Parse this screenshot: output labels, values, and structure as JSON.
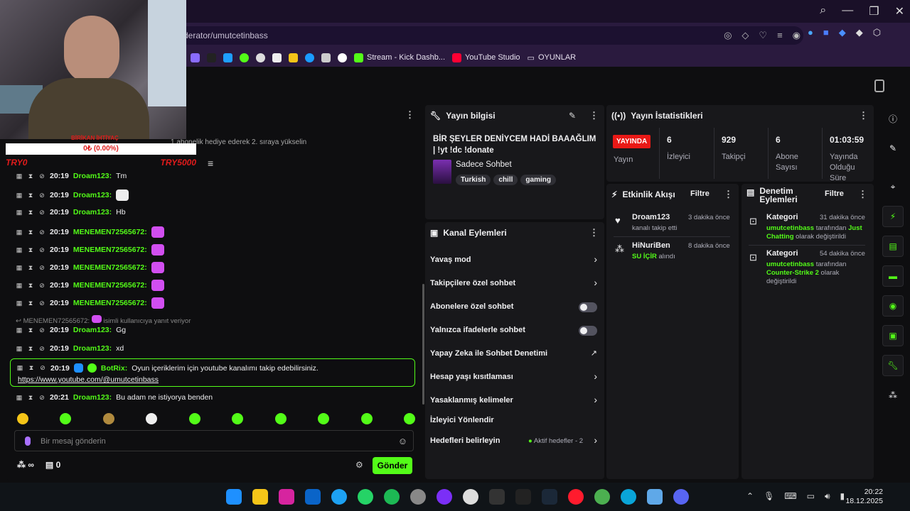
{
  "browser": {
    "address": "derator/umutcetinbass",
    "bookmarks": [
      "Stream - Kick Dashb...",
      "YouTube Studio",
      "OYUNLAR"
    ]
  },
  "overlay": {
    "top_text": "BİRİKAN İHTİYAÇ",
    "progress": "0₺ (0.00%)",
    "progress_value": 0,
    "left_label": "TRY0",
    "right_label": "TRY5000"
  },
  "chat": {
    "info": "1 abonelik hediye ederek 2. sıraya yükselin",
    "messages": [
      {
        "time": "20:19",
        "user": "Droam123:",
        "text": "Tm"
      },
      {
        "time": "20:19",
        "user": "Droam123:",
        "text": ""
      },
      {
        "time": "20:19",
        "user": "Droam123:",
        "text": "Hb"
      },
      {
        "time": "20:19",
        "user": "MENEMEN72565672:",
        "text": ""
      },
      {
        "time": "20:19",
        "user": "MENEMEN72565672:",
        "text": ""
      },
      {
        "time": "20:19",
        "user": "MENEMEN72565672:",
        "text": ""
      },
      {
        "time": "20:19",
        "user": "MENEMEN72565672:",
        "text": ""
      },
      {
        "time": "20:19",
        "user": "MENEMEN72565672:",
        "text": ""
      }
    ],
    "reply_prefix": "MENEMEN72565672:",
    "reply_suffix": "isimli kullanıcıya yanıt veriyor",
    "after_reply": [
      {
        "time": "20:19",
        "user": "Droam123:",
        "text": "Gg"
      },
      {
        "time": "20:19",
        "user": "Droam123:",
        "text": "xd"
      }
    ],
    "bot": {
      "time": "20:19",
      "user": "BotRix:",
      "text": "Oyun içeriklerim için youtube kanalımı takip edebilirsiniz.",
      "link": "https://www.youtube.com/@umutcetinbass"
    },
    "last": {
      "time": "20:21",
      "user": "Droam123:",
      "text": "Bu adam ne istiyorya benden"
    },
    "input_placeholder": "Bir mesaj gönderin",
    "points": "∞",
    "gift_count": "0",
    "send_label": "Gönder"
  },
  "stream_info": {
    "title": "Yayın bilgisi",
    "stream_title": "BİR ŞEYLER DENİYCEM HADİ BAAAĞLIM | !yt !dc !donate",
    "category": "Sadece Sohbet",
    "tags": [
      "Turkish",
      "chill",
      "gaming"
    ]
  },
  "channel_actions": {
    "title": "Kanal Eylemleri",
    "items": [
      {
        "label": "Yavaş mod",
        "control": "chevron"
      },
      {
        "label": "Takipçilere özel sohbet",
        "control": "chevron"
      },
      {
        "label": "Abonelere özel sohbet",
        "control": "toggle"
      },
      {
        "label": "Yalnızca ifadelerle sohbet",
        "control": "toggle"
      },
      {
        "label": "Yapay Zeka ile Sohbet Denetimi",
        "control": "external"
      },
      {
        "label": "Hesap yaşı kısıtlaması",
        "control": "chevron"
      },
      {
        "label": "Yasaklanmış kelimeler",
        "control": "chevron"
      },
      {
        "label": "İzleyici Yönlendir",
        "control": "none"
      },
      {
        "label": "Hedefleri belirleyin",
        "control": "chevron"
      }
    ],
    "goals_status": "Aktif hedefler - 2"
  },
  "stats": {
    "title": "Yayın İstatistikleri",
    "live_badge": "YAYINDA",
    "live_label": "Yayın",
    "columns": [
      {
        "value": "6",
        "label": "İzleyici"
      },
      {
        "value": "929",
        "label": "Takipçi"
      },
      {
        "value": "6",
        "label": "Abone Sayısı"
      },
      {
        "value": "01:03:59",
        "label": "Yayında Olduğu Süre"
      }
    ]
  },
  "activity": {
    "title": "Etkinlik Akışı",
    "filter": "Filtre",
    "items": [
      {
        "user": "Droam123",
        "desc": "kanalı takip etti",
        "time": "3 dakika önce"
      },
      {
        "user": "HiNuriBen",
        "reward": "SU İÇİR",
        "desc": "alındı",
        "time": "8 dakika önce"
      }
    ]
  },
  "moderation": {
    "title_line1": "Denetim",
    "title_line2": "Eylemleri",
    "filter": "Filtre",
    "items": [
      {
        "kind": "Kategori",
        "time": "31 dakika önce",
        "user": "umutcetinbass",
        "mid": "tarafından",
        "category": "Just Chatting",
        "end": "olarak değiştirildi"
      },
      {
        "kind": "Kategori",
        "time": "54 dakika önce",
        "user": "umutcetinbass",
        "mid": "tarafından",
        "category": "Counter-Strike 2",
        "end": "olarak değiştirildi"
      }
    ]
  },
  "taskbar": {
    "time": "20:22",
    "date": "18.12.2025"
  }
}
